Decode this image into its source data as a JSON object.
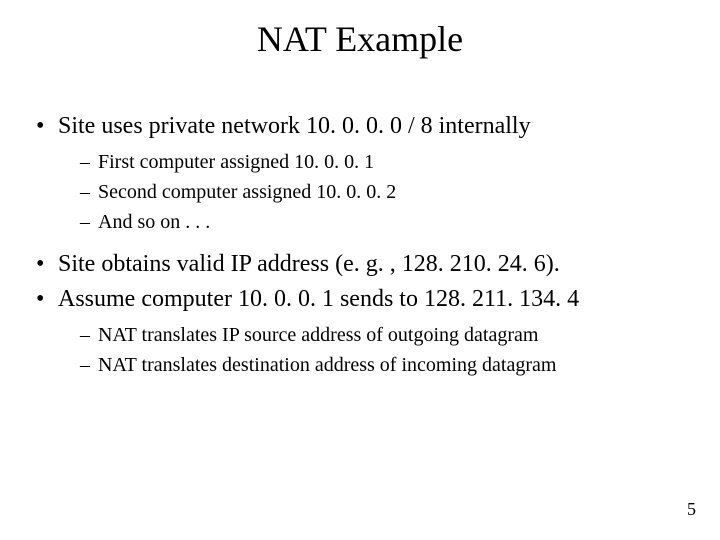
{
  "title": "NAT Example",
  "bullets": [
    {
      "text": "Site uses private network 10. 0. 0. 0 / 8 internally",
      "sub": [
        "First computer assigned 10. 0. 0. 1",
        "Second computer assigned 10. 0. 0. 2",
        "And so on . . ."
      ]
    },
    {
      "text": "Site obtains valid IP address (e. g. , 128. 210. 24. 6).",
      "sub": []
    },
    {
      "text": "Assume computer 10. 0. 0. 1 sends to 128. 211. 134. 4",
      "sub": [
        "NAT translates IP source address of outgoing datagram",
        "NAT translates destination address of incoming datagram"
      ]
    }
  ],
  "page_number": "5"
}
